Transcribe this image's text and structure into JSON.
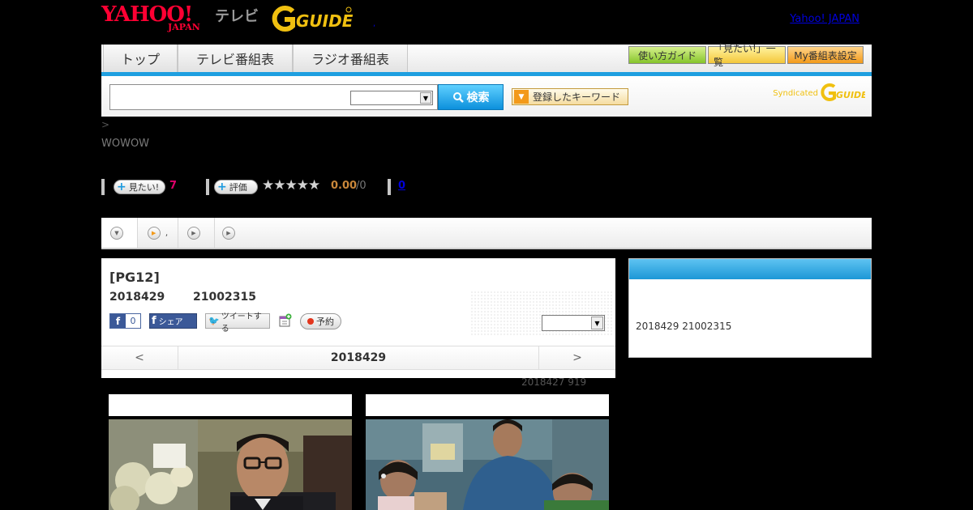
{
  "header": {
    "logo_yahoo": "YAHOO!",
    "logo_yahoo_sub": "JAPAN",
    "logo_tv": "テレビ",
    "logo_gguide": "G-GUIDE",
    "top_link": "Yahoo! JAPAN",
    "dot_link": ","
  },
  "nav": {
    "tabs": [
      {
        "label": "トップ"
      },
      {
        "label": "テレビ番組表"
      },
      {
        "label": "ラジオ番組表"
      }
    ],
    "utils": [
      {
        "label": "使い方ガイド"
      },
      {
        "label": "「見たい!」一覧"
      },
      {
        "label": "My番組表設定"
      }
    ]
  },
  "search": {
    "input_value": "",
    "select_value": "",
    "button_label": "検索",
    "keyword_button_label": "登録したキーワード",
    "syndicated_label": "Syndicated"
  },
  "breadcrumb": ">",
  "channel": "WOWOW",
  "stats": {
    "mitai_label": "見たい!",
    "mitai_count": "7",
    "rating_label": "評価",
    "rating_stars": "★★★★★",
    "rating_score": "0.00",
    "rating_count": "/0",
    "review_link": "0"
  },
  "content_tabs": [
    {
      "label": ""
    },
    {
      "label": ","
    },
    {
      "label": ""
    },
    {
      "label": ""
    }
  ],
  "program": {
    "title": "[PG12]",
    "date": "2018429",
    "time": "21002315",
    "fb_like_count": "0",
    "fb_share_label": "シェア",
    "tweet_label": "ツイートする",
    "reserve_label": "予約",
    "select_value": ""
  },
  "date_nav": {
    "prev": "<",
    "current": "2018429",
    "next": ">"
  },
  "updated": "2018427  919",
  "side": {
    "text": "2018429  21002315"
  },
  "colors": {
    "accent_blue": "#1e9fe0",
    "yahoo_red": "#ff0033",
    "gguide_yellow": "#f0c010",
    "mitai_pink": "#e0006a",
    "score_orange": "#c9873a"
  }
}
